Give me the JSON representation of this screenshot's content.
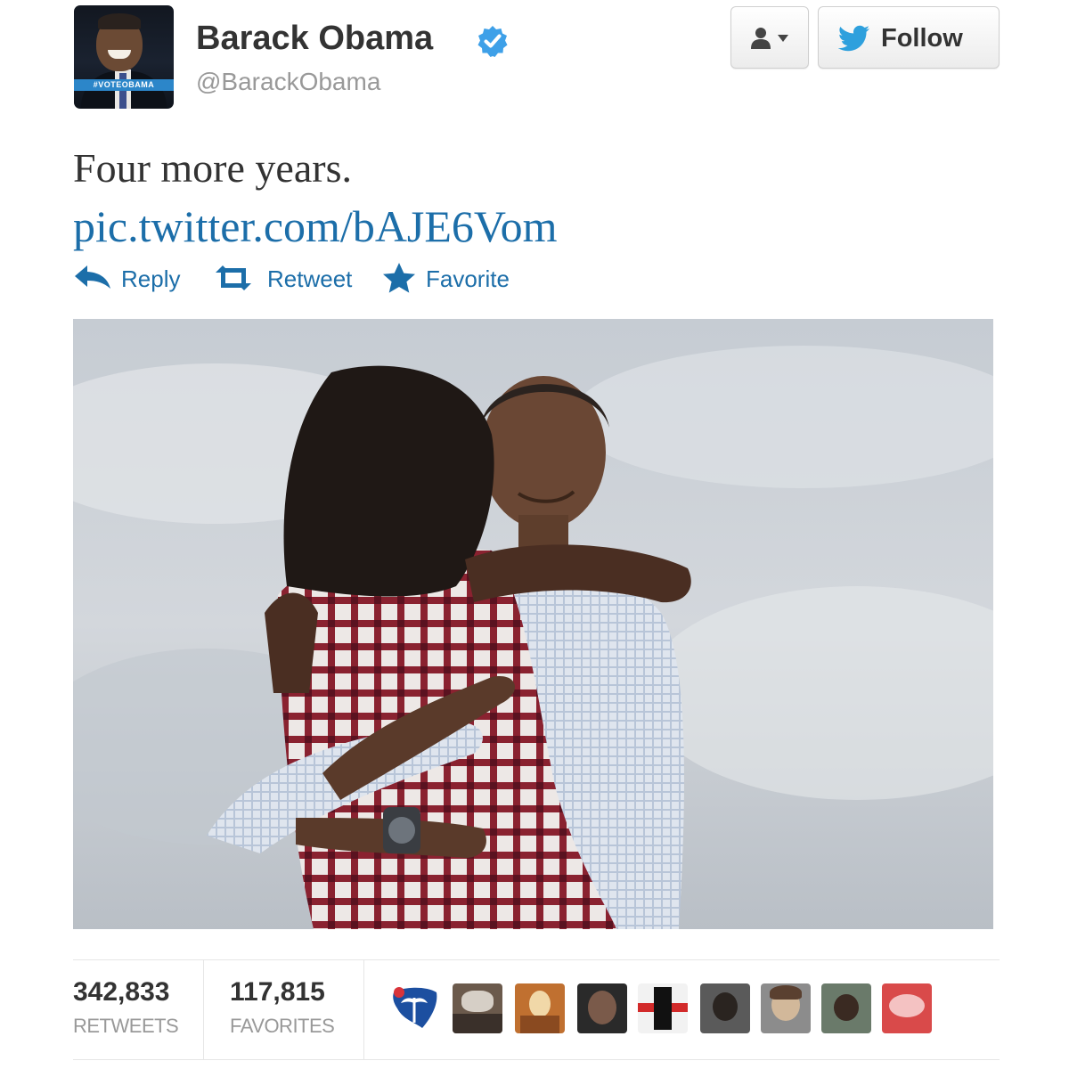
{
  "profile": {
    "name": "Barack Obama",
    "screen_name": "@BarackObama",
    "avatar_banner": "#VOTEOBAMA",
    "verified_icon": "verified-badge-icon"
  },
  "header_actions": {
    "user_dropdown_icon": "user-icon",
    "follow_label": "Follow",
    "follow_icon": "twitter-bird-icon"
  },
  "tweet": {
    "text": "Four more years.",
    "link": "pic.twitter.com/bAJE6Vom"
  },
  "actions": {
    "reply": "Reply",
    "retweet": "Retweet",
    "favorite": "Favorite"
  },
  "stats": {
    "retweets_count": "342,833",
    "retweets_label": "RETWEETS",
    "favorites_count": "117,815",
    "favorites_label": "FAVORITES"
  },
  "retweeter_avatars": [
    "south-carolina-avatar",
    "user-avatar-2",
    "user-avatar-3",
    "user-avatar-4",
    "user-avatar-5",
    "user-avatar-6",
    "user-avatar-7",
    "user-avatar-8",
    "user-avatar-9"
  ],
  "colors": {
    "link_blue": "#1c6ea9",
    "twitter_blue": "#2ea0dd",
    "muted_gray": "#999999"
  }
}
